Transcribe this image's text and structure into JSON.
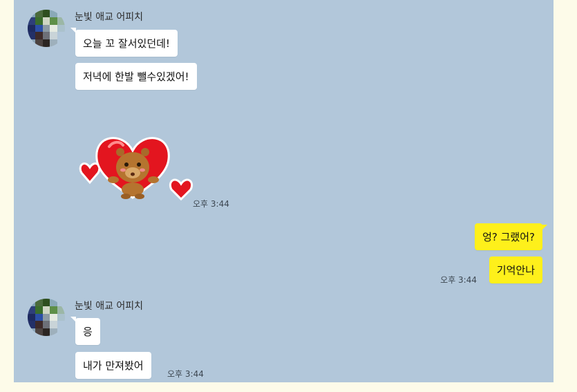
{
  "colors": {
    "chat_background": "#b2c7da",
    "incoming_bubble": "#ffffff",
    "outgoing_bubble": "#fef01b",
    "page_background": "#fdfbe9"
  },
  "conversation": {
    "group1": {
      "sender": "눈빛 애교 어피치",
      "messages": [
        "오늘 꼬 잘서있던데!",
        "저녁에 한발 뺄수있겠어!"
      ],
      "sticker": {
        "icon": "heart-bear-sticker-icon"
      },
      "time": "오후 3:44"
    },
    "group2": {
      "messages": [
        "엉? 그랬어?",
        "기억안나"
      ],
      "time": "오후 3:44"
    },
    "group3": {
      "sender": "눈빛 애교 어피치",
      "messages": [
        "응",
        "내가 만져봤어"
      ],
      "time": "오후 3:44"
    }
  }
}
